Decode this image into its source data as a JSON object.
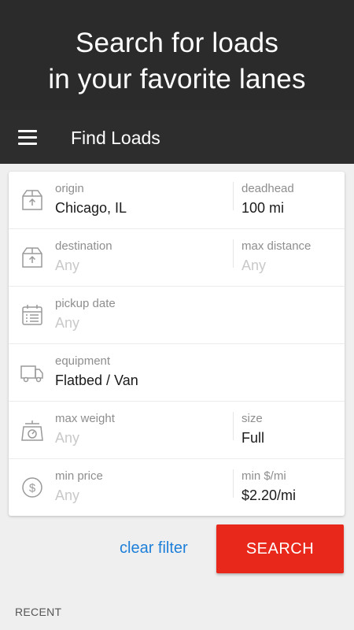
{
  "promo": {
    "line1": "Search for loads",
    "line2": "in your favorite lanes"
  },
  "appbar": {
    "menu_icon": "hamburger-menu-icon",
    "title": "Find Loads"
  },
  "form": {
    "origin": {
      "label": "origin",
      "value": "Chicago, IL",
      "icon": "box-upload-icon"
    },
    "deadhead": {
      "label": "deadhead",
      "value": "100 mi"
    },
    "destination": {
      "label": "destination",
      "placeholder": "Any",
      "icon": "box-upload-icon"
    },
    "max_distance": {
      "label": "max distance",
      "placeholder": "Any"
    },
    "pickup_date": {
      "label": "pickup date",
      "placeholder": "Any",
      "icon": "calendar-icon"
    },
    "equipment": {
      "label": "equipment",
      "value": "Flatbed / Van",
      "icon": "truck-icon"
    },
    "max_weight": {
      "label": "max weight",
      "placeholder": "Any",
      "icon": "scale-icon"
    },
    "size": {
      "label": "size",
      "value": "Full"
    },
    "min_price": {
      "label": "min price",
      "placeholder": "Any",
      "icon": "dollar-circle-icon"
    },
    "min_rate": {
      "label": "min $/mi",
      "value": "$2.20/mi"
    }
  },
  "actions": {
    "clear_label": "clear filter",
    "search_label": "SEARCH"
  },
  "recent": {
    "heading": "RECENT"
  },
  "colors": {
    "header_bg": "#2b2b2b",
    "accent_red": "#e8281a",
    "link_blue": "#1e7fd9",
    "page_bg": "#efefef"
  }
}
